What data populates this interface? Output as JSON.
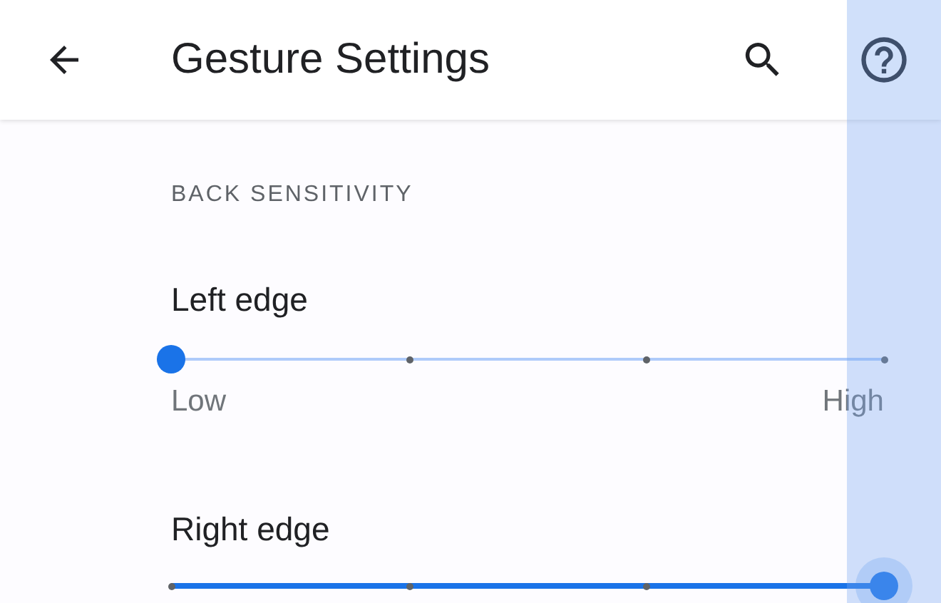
{
  "app_bar": {
    "title": "Gesture Settings"
  },
  "section": {
    "header": "BACK SENSITIVITY"
  },
  "sliders": [
    {
      "label": "Left edge",
      "level": 0,
      "active": false,
      "min_label": "Low",
      "max_label": "High"
    },
    {
      "label": "Right edge",
      "level": 1,
      "active": true
    }
  ],
  "edge_preview": {
    "visible": true
  }
}
